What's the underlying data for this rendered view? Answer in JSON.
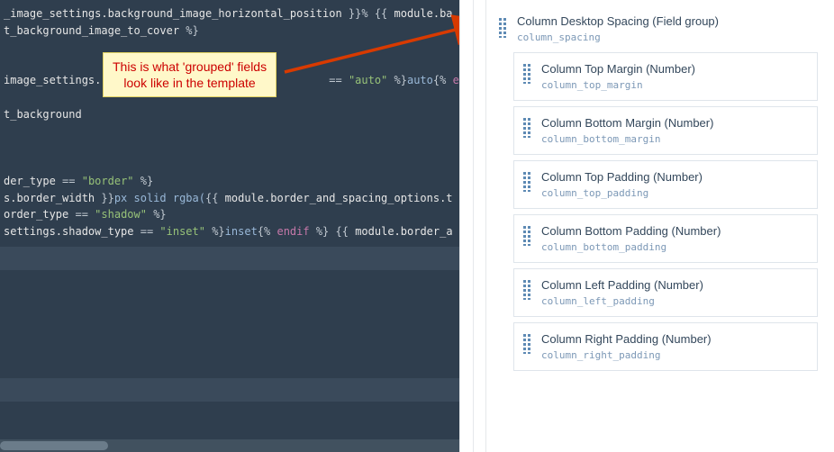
{
  "annotation": {
    "text": "This is what 'grouped' fields\nlook like in the template"
  },
  "code": {
    "lines": [
      {
        "segs": [
          {
            "t": "_image_settings.background_image_horizontal_position ",
            "c": "tok-var"
          },
          {
            "t": "}}%",
            "c": "tok-op"
          },
          {
            "t": " ",
            "c": ""
          },
          {
            "t": "{{",
            "c": "tok-op"
          },
          {
            "t": " module.ba",
            "c": "tok-var"
          }
        ]
      },
      {
        "segs": [
          {
            "t": "t_background_image_to_cover ",
            "c": "tok-var"
          },
          {
            "t": "%}",
            "c": "tok-op"
          }
        ]
      },
      {
        "segs": []
      },
      {
        "segs": []
      },
      {
        "segs": [
          {
            "t": "image_settings.",
            "c": "tok-var"
          },
          {
            "t": "                                   ",
            "c": ""
          },
          {
            "t": "==",
            "c": "tok-op"
          },
          {
            "t": " ",
            "c": ""
          },
          {
            "t": "\"auto\"",
            "c": "tok-str"
          },
          {
            "t": " %}",
            "c": "tok-op"
          },
          {
            "t": "auto",
            "c": "tok-tag"
          },
          {
            "t": "{% ",
            "c": "tok-op"
          },
          {
            "t": "else",
            "c": "tok-kw"
          }
        ]
      },
      {
        "segs": []
      },
      {
        "segs": [
          {
            "t": "t_background",
            "c": "tok-var"
          }
        ]
      },
      {
        "segs": []
      },
      {
        "segs": []
      },
      {
        "segs": []
      },
      {
        "segs": [
          {
            "t": "der_type ",
            "c": "tok-var"
          },
          {
            "t": "==",
            "c": "tok-op"
          },
          {
            "t": " ",
            "c": ""
          },
          {
            "t": "\"border\"",
            "c": "tok-str"
          },
          {
            "t": " %}",
            "c": "tok-op"
          }
        ]
      },
      {
        "segs": [
          {
            "t": "s.border_width ",
            "c": "tok-var"
          },
          {
            "t": "}}",
            "c": "tok-op"
          },
          {
            "t": "px solid rgba(",
            "c": "tok-tag"
          },
          {
            "t": "{{",
            "c": "tok-op"
          },
          {
            "t": " module.border_and_spacing_options.t",
            "c": "tok-var"
          }
        ]
      },
      {
        "segs": [
          {
            "t": "order_type ",
            "c": "tok-var"
          },
          {
            "t": "==",
            "c": "tok-op"
          },
          {
            "t": " ",
            "c": ""
          },
          {
            "t": "\"shadow\"",
            "c": "tok-str"
          },
          {
            "t": " %}",
            "c": "tok-op"
          }
        ]
      },
      {
        "segs": [
          {
            "t": "settings.shadow_type ",
            "c": "tok-var"
          },
          {
            "t": "==",
            "c": "tok-op"
          },
          {
            "t": " ",
            "c": ""
          },
          {
            "t": "\"inset\"",
            "c": "tok-str"
          },
          {
            "t": " %}",
            "c": "tok-op"
          },
          {
            "t": "inset",
            "c": "tok-tag"
          },
          {
            "t": "{% ",
            "c": "tok-op"
          },
          {
            "t": "endif",
            "c": "tok-kw"
          },
          {
            "t": " %}",
            "c": "tok-op"
          },
          {
            "t": " ",
            "c": ""
          },
          {
            "t": "{{",
            "c": "tok-op"
          },
          {
            "t": " module.border_a",
            "c": "tok-var"
          }
        ]
      }
    ]
  },
  "fields": {
    "group": {
      "title": "Column Desktop Spacing (Field group)",
      "key": "column_spacing"
    },
    "children": [
      {
        "title": "Column Top Margin (Number)",
        "key": "column_top_margin"
      },
      {
        "title": "Column Bottom Margin (Number)",
        "key": "column_bottom_margin"
      },
      {
        "title": "Column Top Padding (Number)",
        "key": "column_top_padding"
      },
      {
        "title": "Column Bottom Padding (Number)",
        "key": "column_bottom_padding"
      },
      {
        "title": "Column Left Padding (Number)",
        "key": "column_left_padding"
      },
      {
        "title": "Column Right Padding (Number)",
        "key": "column_right_padding"
      }
    ]
  }
}
